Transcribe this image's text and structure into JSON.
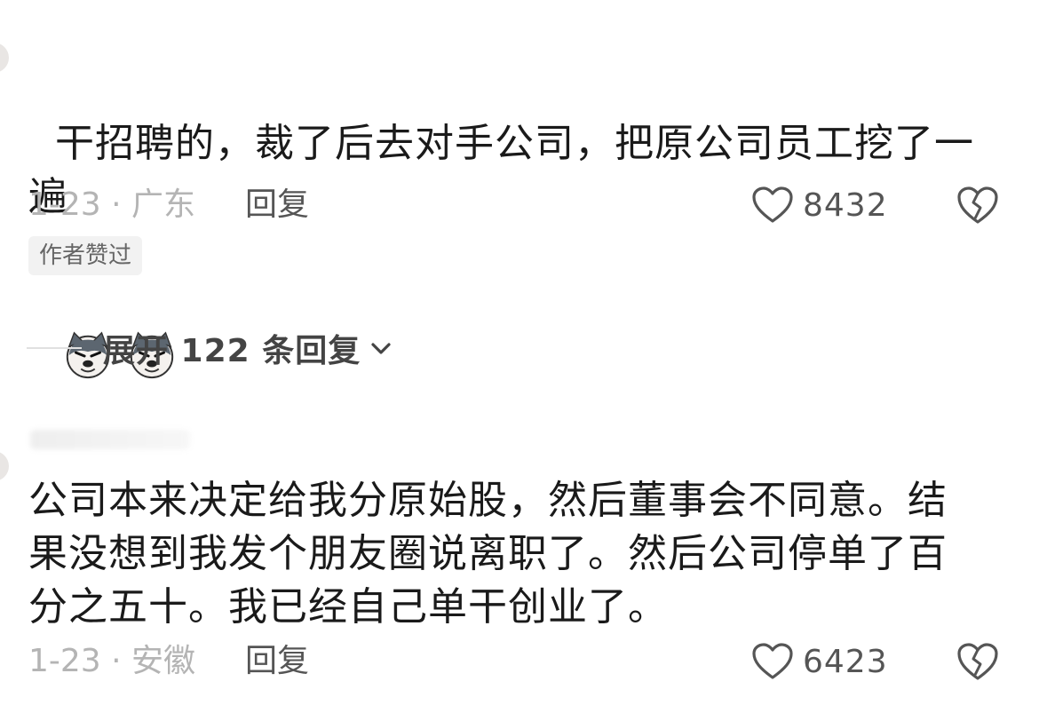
{
  "comments": [
    {
      "text": "干招聘的，裁了后去对手公司，把原公司员工挖了一\n遍",
      "emoji": [
        "dog-face-emoji",
        "dog-face-emoji"
      ],
      "meta": "1-23 · 广东",
      "reply_label": "回复",
      "likes": "8432",
      "badge": "作者赞过"
    },
    {
      "text": "公司本来决定给我分原始股，然后董事会不同意。结\n果没想到我发个朋友圈说离职了。然后公司停单了百\n分之五十。我已经自己单干创业了。",
      "meta": "1-23 · 安徽",
      "reply_label": "回复",
      "likes": "6423"
    }
  ],
  "expand": {
    "label": "展开 122 条回复"
  },
  "colors": {
    "meta": "#b4b4b4",
    "text": "#1a1a1a",
    "badge_bg": "#f2f2f2"
  }
}
